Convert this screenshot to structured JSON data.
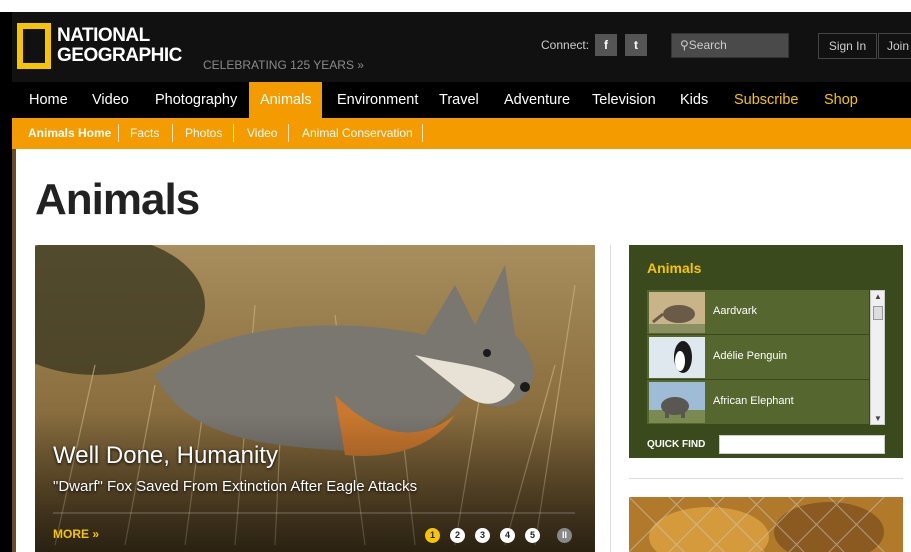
{
  "header": {
    "logo_line1": "NATIONAL",
    "logo_line2": "GEOGRAPHIC",
    "celebrating": "CELEBRATING 125 YEARS »",
    "connect_label": "Connect:",
    "facebook": "f",
    "twitter": "t",
    "search_placeholder": "Search",
    "sign_in": "Sign In",
    "join": "Join"
  },
  "main_nav": [
    {
      "label": "Home"
    },
    {
      "label": "Video"
    },
    {
      "label": "Photography"
    },
    {
      "label": "Animals"
    },
    {
      "label": "Environment"
    },
    {
      "label": "Travel"
    },
    {
      "label": "Adventure"
    },
    {
      "label": "Television"
    },
    {
      "label": "Kids"
    },
    {
      "label": "Subscribe"
    },
    {
      "label": "Shop"
    }
  ],
  "sub_nav": [
    {
      "label": "Animals Home"
    },
    {
      "label": "Facts"
    },
    {
      "label": "Photos"
    },
    {
      "label": "Video"
    },
    {
      "label": "Animal Conservation"
    }
  ],
  "page_title": "Animals",
  "hero": {
    "headline": "Well Done, Humanity",
    "subhead": "\"Dwarf\" Fox Saved From Extinction After Eagle Attacks",
    "more": "MORE »",
    "slides": [
      "1",
      "2",
      "3",
      "4",
      "5"
    ],
    "pause": "II"
  },
  "animals_widget": {
    "title": "Animals",
    "items": [
      {
        "label": "Aardvark"
      },
      {
        "label": "Adélie Penguin"
      },
      {
        "label": "African Elephant"
      }
    ],
    "quick_find": "QUICK FIND"
  },
  "colors": {
    "brand_yellow": "#f6c400",
    "nav_orange": "#f49b00",
    "widget_green": "#3b4a1c"
  }
}
